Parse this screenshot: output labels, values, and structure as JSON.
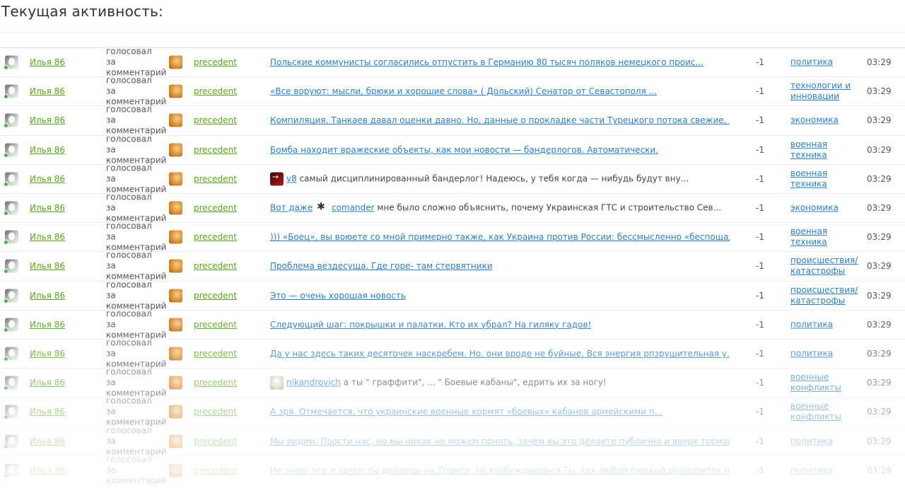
{
  "page": {
    "title": "Текущая активность:"
  },
  "rows": [
    {
      "user": "Илья 86",
      "action": "голосовал за комментарий",
      "target_user": "precedent",
      "comment": "Польские коммунисты согласились отпустить в Германию 80 тысяч поляков немецкого проис...",
      "comment_style": "link",
      "score": "-1",
      "category": "политика",
      "time": "03:29",
      "opacity": 1
    },
    {
      "user": "Илья 86",
      "action": "голосовал за комментарий",
      "target_user": "precedent",
      "comment": "«Все воруют: мысли, брюки и хорошие слова» ( Дольский) Сенатор от Севастополя ...",
      "comment_style": "link",
      "score": "-1",
      "category": "технологии и инновации",
      "time": "03:29",
      "opacity": 1
    },
    {
      "user": "Илья 86",
      "action": "голосовал за комментарий",
      "target_user": "precedent",
      "comment": "Компиляция. Танкаев давал оценки давно. Но, данные о прокладке части Турецкого потока свежие, с с...",
      "comment_style": "link",
      "score": "-1",
      "category": "экономика",
      "time": "03:29",
      "opacity": 1
    },
    {
      "user": "Илья 86",
      "action": "голосовал за комментарий",
      "target_user": "precedent",
      "comment": "Бомба находит вражеские объекты, как мои новости — бандерлогов. Автоматически. ",
      "comment_style": "link",
      "score": "-1",
      "category": "военная техника",
      "time": "03:29",
      "opacity": 1
    },
    {
      "user": "Илья 86",
      "action": "голосовал за комментарий",
      "target_user": "precedent",
      "comment_prefix_avatar": "dark",
      "comment_prefix_user": "v8",
      "comment_prefix_user_color": "red",
      "comment": " самый дисциплинированный бандерлог! Надеюсь, у тебя когда — нибудь будут вну...",
      "comment_style": "text",
      "score": "-1",
      "category": "военная техника",
      "time": "03:29",
      "opacity": 1
    },
    {
      "user": "Илья 86",
      "action": "голосовал за комментарий",
      "target_user": "precedent",
      "comment_lead_link": "Вот даже",
      "comment_prefix_avatar": "fig",
      "comment_prefix_user": "comander",
      "comment_prefix_user_color": "red",
      "comment": " мне было сложно объяснить, почему Украинская ГТС и строительство Сев...",
      "comment_style": "text",
      "score": "-1",
      "category": "экономика",
      "time": "03:29",
      "opacity": 1
    },
    {
      "user": "Илья 86",
      "action": "голосовал за комментарий",
      "target_user": "precedent",
      "comment": "))) «Боец», вы воюете со мной примерно также, как Украина против России: бессмысленно «беспощадно...",
      "comment_style": "link",
      "score": "-1",
      "category": "военная техника",
      "time": "03:29",
      "opacity": 1
    },
    {
      "user": "Илья 86",
      "action": "голосовал за комментарий",
      "target_user": "precedent",
      "comment": "Проблема вездесуща. Где горе- там стервятники ",
      "comment_style": "link",
      "score": "-1",
      "category": "происшествия/ катастрофы",
      "time": "03:29",
      "opacity": 1
    },
    {
      "user": "Илья 86",
      "action": "голосовал за комментарий",
      "target_user": "precedent",
      "comment": "Это — очень хорошая новость",
      "comment_style": "link",
      "score": "-1",
      "category": "происшествия/ катастрофы",
      "time": "03:29",
      "opacity": 1
    },
    {
      "user": "Илья 86",
      "action": "голосовал за комментарий",
      "target_user": "precedent",
      "comment": "Следующий шаг: покрышки и палатки. Кто их убрал? На гиляку гадов! ",
      "comment_style": "link",
      "score": "-1",
      "category": "политика",
      "time": "03:29",
      "opacity": 0.92
    },
    {
      "user": "Илья 86",
      "action": "голосовал за комментарий",
      "target_user": "precedent",
      "comment": "Да у нас здесь таких десяточек наскребем.  Но, они вроде не буйные.  Вся энергия рпзрушительная у...",
      "comment_style": "link",
      "score": "-1",
      "category": "политика",
      "time": "03:29",
      "opacity": 0.78
    },
    {
      "user": "Илья 86",
      "action": "голосовал за комментарий",
      "target_user": "precedent",
      "comment_prefix_avatar": "green",
      "comment_prefix_user": "nikandrovich",
      "comment_prefix_user_color": "green",
      "comment": " а ты \" граффити\", ... \" Боевые кабаны\", едрить их за ногу!",
      "comment_style": "text",
      "score": "-1",
      "category": "военные конфликты",
      "time": "03:29",
      "opacity": 0.62
    },
    {
      "user": "Илья 86",
      "action": "голосовал за комментарий",
      "target_user": "precedent",
      "comment": "А зря. Отмечается, что украинские военные кормят «боевых» кабанов армейскими п...",
      "comment_style": "link",
      "score": "-1",
      "category": "военные конфликты",
      "time": "03:29",
      "opacity": 0.46
    },
    {
      "user": "Илья 86",
      "action": "голосовал за комментарий",
      "target_user": "precedent",
      "comment": "Мы видим.  Прости нас, но мы никак не можем понять,  зачем вы это делаете публично и вверх тормаш...",
      "comment_style": "link",
      "score": "-1",
      "category": "политика",
      "time": "03:29",
      "opacity": 0.3
    },
    {
      "user": "Илья 86",
      "action": "голосовал за комментарий",
      "target_user": "precedent",
      "comment": "Не знаю, что и зачем ты делаешь на Трампа, но возбуждаешься Ты, как любой лживый руинопитек на лю...",
      "comment_style": "link",
      "score": "-1",
      "category": "политика",
      "time": "03:29",
      "opacity": 0.18
    }
  ]
}
